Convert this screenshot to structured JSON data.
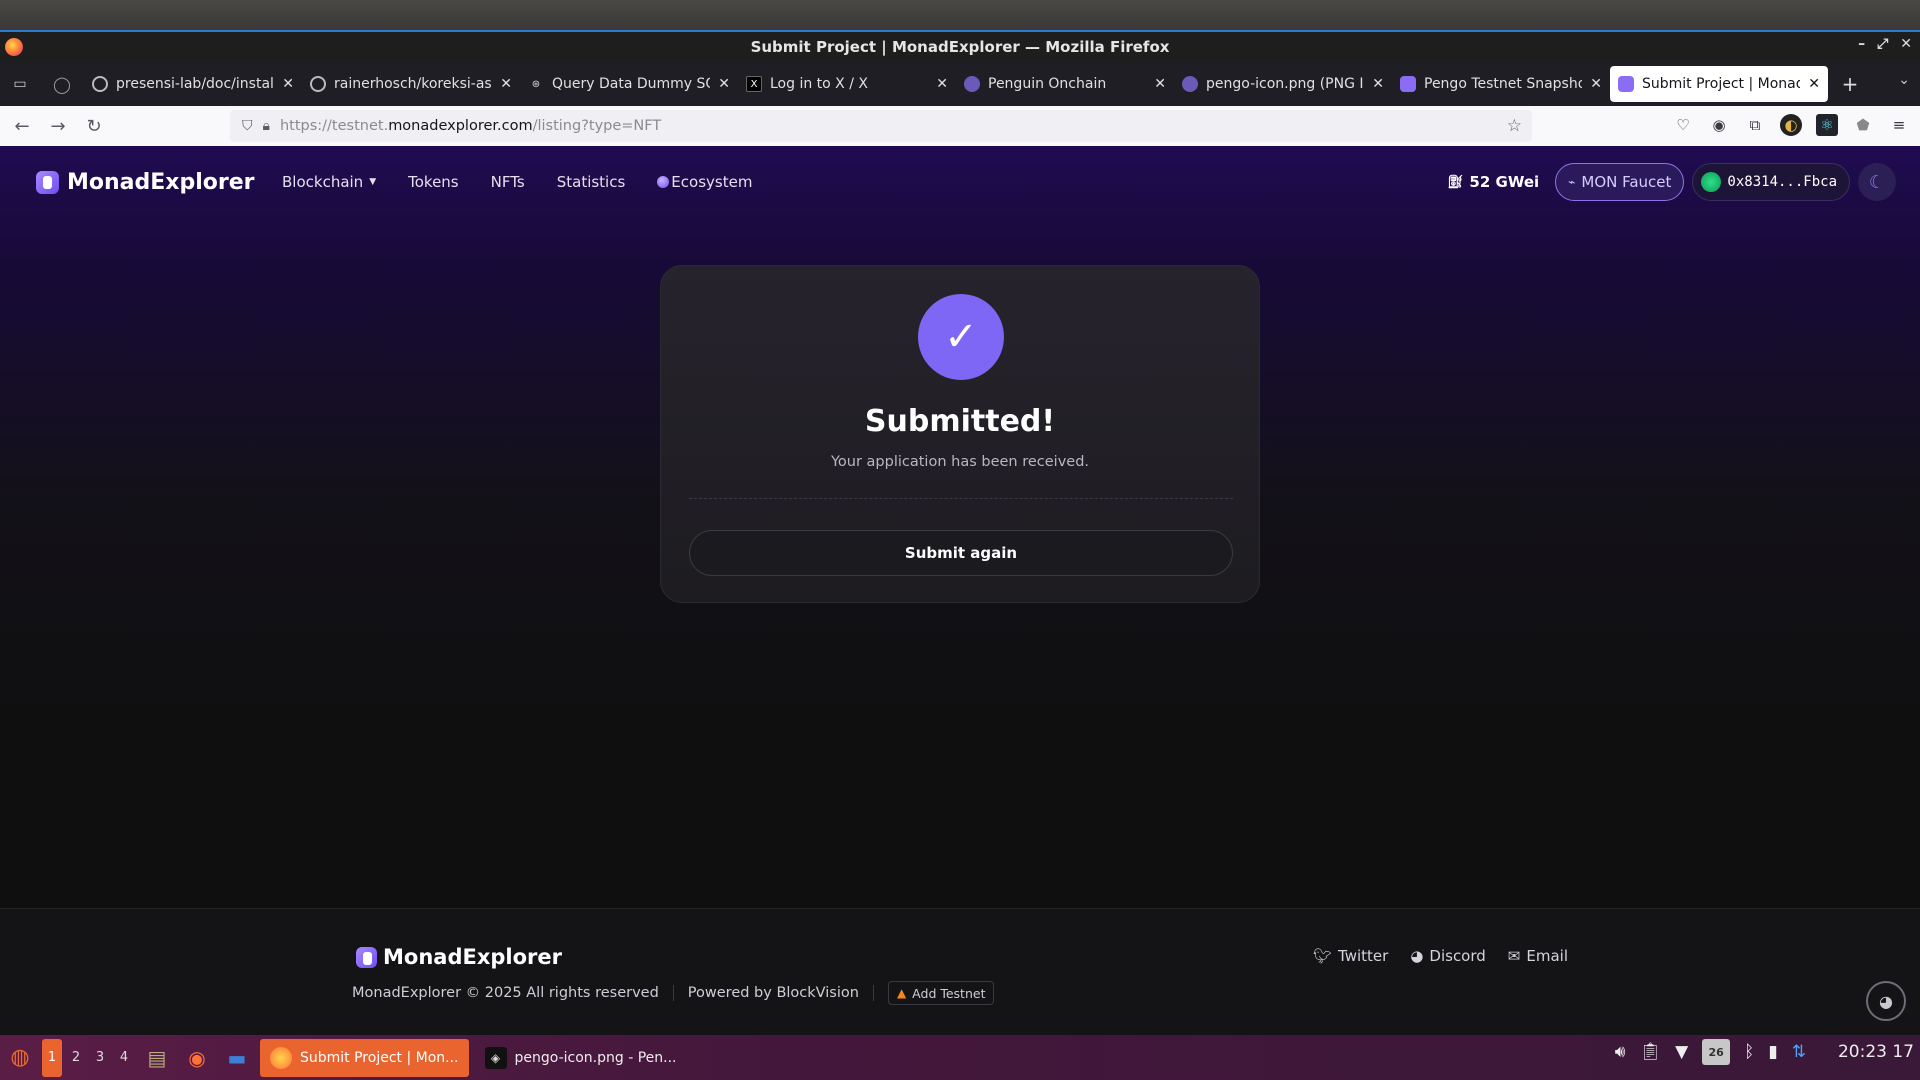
{
  "window": {
    "title": "Submit Project | MonadExplorer — Mozilla Firefox"
  },
  "tabs": [
    {
      "label": "presensi-lab/doc/installa",
      "icon": "github-icon"
    },
    {
      "label": "rainerhosch/koreksi-asis",
      "icon": "github-icon"
    },
    {
      "label": "Query Data Dummy SQL",
      "icon": "openai-icon"
    },
    {
      "label": "Log in to X / X",
      "icon": "x-icon"
    },
    {
      "label": "Penguin Onchain",
      "icon": "penguin-icon"
    },
    {
      "label": "pengo-icon.png (PNG Im",
      "icon": "penguin-icon"
    },
    {
      "label": "Pengo Testnet Snapshot",
      "icon": "monad-icon"
    },
    {
      "label": "Submit Project | MonadE",
      "icon": "monad-icon"
    }
  ],
  "url": {
    "prefix": "https://testnet.",
    "host": "monadexplorer.com",
    "path": "/listing?type=NFT"
  },
  "site": {
    "brand": "MonadExplorer",
    "menu": {
      "blockchain": "Blockchain",
      "tokens": "Tokens",
      "nfts": "NFTs",
      "statistics": "Statistics",
      "ecosystem": "Ecosystem"
    },
    "gas": "52 GWei",
    "faucet": "MON Faucet",
    "wallet": "0x8314...Fbca"
  },
  "card": {
    "title": "Submitted!",
    "subtitle": "Your application has been received.",
    "button": "Submit again"
  },
  "footer": {
    "brand": "MonadExplorer",
    "twitter": "Twitter",
    "discord": "Discord",
    "email": "Email",
    "copyright": "MonadExplorer © 2025 All rights reserved",
    "powered": "Powered by BlockVision",
    "add_testnet": "Add Testnet"
  },
  "taskbar": {
    "workspaces": [
      "1",
      "2",
      "3",
      "4"
    ],
    "windows": [
      {
        "label": "Submit Project | Mon..."
      },
      {
        "label": "pengo-icon.png - Pen..."
      }
    ],
    "battery": "26",
    "clock": "20:23  17"
  },
  "colors": {
    "accent": "#7f67f6",
    "taskbar_active": "#e9642f"
  }
}
